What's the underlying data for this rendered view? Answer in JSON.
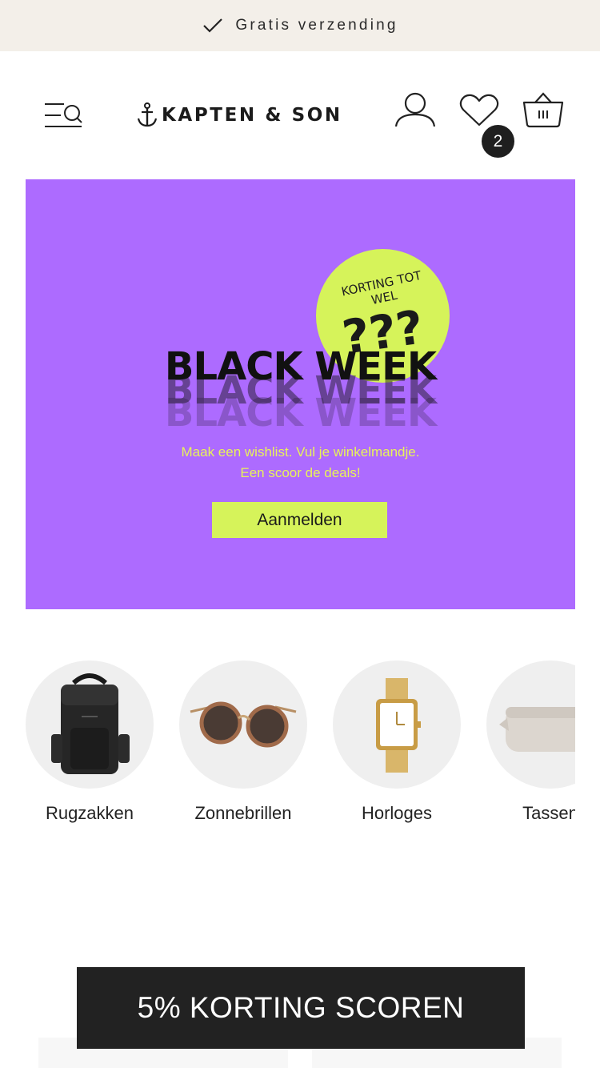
{
  "topbar": {
    "text": "Gratis verzending",
    "icon": "check-icon"
  },
  "header": {
    "logo_text": "KAPTEN & SON",
    "logo_icon": "anchor-icon",
    "menu_icon": "menu-search-icon",
    "account_icon": "user-icon",
    "wishlist_icon": "heart-icon",
    "wishlist_count": "2",
    "cart_icon": "basket-icon"
  },
  "banner": {
    "bg_color": "#ad6bff",
    "accent_color": "#d6f35a",
    "badge_line1": "KORTING TOT",
    "badge_line2": "WEL",
    "badge_question": "???",
    "headline": "BLACK WEEK",
    "tagline_line1": "Maak een wishlist. Vul je winkelmandje.",
    "tagline_line2": "Een scoor de deals!",
    "cta_label": "Aanmelden"
  },
  "categories": [
    {
      "label": "Rugzakken",
      "icon": "backpack-icon"
    },
    {
      "label": "Zonnebrillen",
      "icon": "sunglasses-icon"
    },
    {
      "label": "Horloges",
      "icon": "watch-icon"
    },
    {
      "label": "Tassen",
      "icon": "bag-icon"
    }
  ],
  "promo": {
    "label": "5% KORTING SCOREN"
  }
}
